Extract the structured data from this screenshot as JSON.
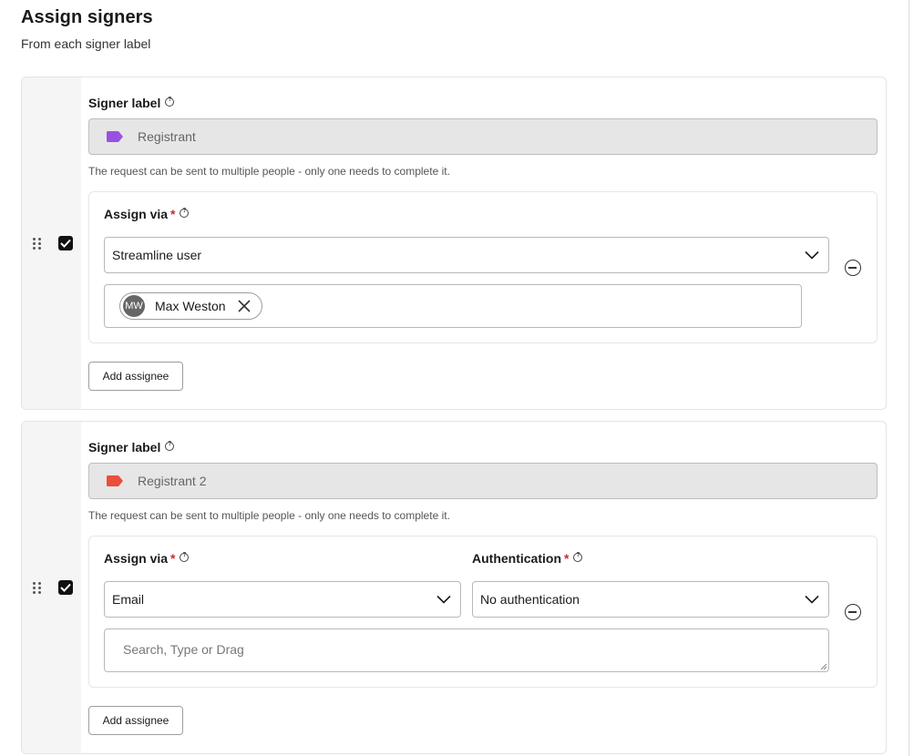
{
  "page": {
    "title": "Assign signers",
    "subtitle": "From each signer label"
  },
  "signers": [
    {
      "checked": true,
      "signer_label_heading": "Signer label",
      "label_value": "Registrant",
      "label_color": "#9b51e0",
      "hint": "The request can be sent to multiple people - only one needs to complete it.",
      "assign_via_label": "Assign via",
      "required_mark": "*",
      "assign_via_value": "Streamline user",
      "assignee": {
        "initials": "MW",
        "name": "Max Weston"
      },
      "add_assignee_label": "Add assignee"
    },
    {
      "checked": true,
      "signer_label_heading": "Signer label",
      "label_value": "Registrant 2",
      "label_color": "#eb4f3c",
      "hint": "The request can be sent to multiple people - only one needs to complete it.",
      "assign_via_label": "Assign via",
      "required_mark": "*",
      "assign_via_value": "Email",
      "authentication_label": "Authentication",
      "authentication_value": "No authentication",
      "search_placeholder": "Search, Type or Drag",
      "add_assignee_label": "Add assignee"
    }
  ],
  "icons": {
    "drag": "drag-handle-icon",
    "check": "checkmark-icon",
    "help": "help-circle-icon",
    "tag": "label-tag-icon",
    "chevron": "chevron-down-icon",
    "remove": "remove-circle-icon",
    "close": "close-icon"
  }
}
